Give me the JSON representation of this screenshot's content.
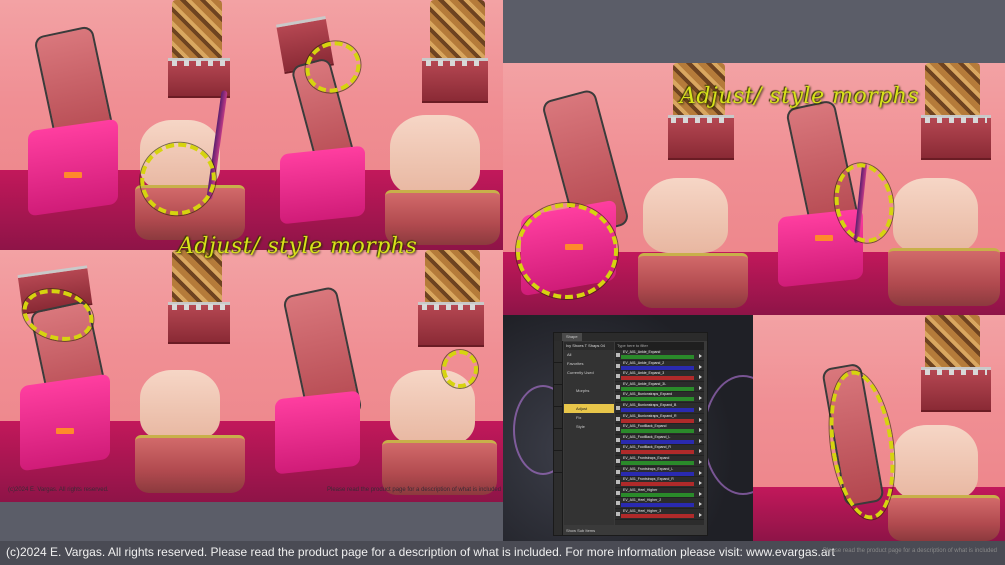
{
  "labels": {
    "style_morphs_left": "Adjust/ style morphs",
    "style_morphs_right": "Adjust/ style morphs"
  },
  "credits": {
    "left_small": "(c)2024 E. Vargas. All rights reserved.",
    "left_small_right": "Please read the product page for a description of what is included",
    "footer_main": "(c)2024 E. Vargas. All rights reserved. Please read the product page for a description of what is included. For more information please visit: www.evargas.art",
    "footer_faint": "Please read the product page for a description of what is included"
  },
  "ui": {
    "tabs": [
      "",
      "Shape"
    ],
    "tree_header": "Ivy Shoes T Shaps 04",
    "tree_items": [
      {
        "label": "All",
        "selected": false,
        "indent": false
      },
      {
        "label": "Favorites",
        "selected": false,
        "indent": false
      },
      {
        "label": "Currently Used",
        "selected": false,
        "indent": false
      },
      {
        "label": "",
        "selected": false,
        "indent": false
      },
      {
        "label": "Morphs",
        "selected": false,
        "indent": true
      },
      {
        "label": "",
        "selected": false,
        "indent": true
      },
      {
        "label": "Adjust",
        "selected": true,
        "indent": true
      },
      {
        "label": "Fix",
        "selected": false,
        "indent": true
      },
      {
        "label": "Style",
        "selected": false,
        "indent": true
      }
    ],
    "list_header": "Type here to filter",
    "rows": [
      {
        "label": "EV_A01_Ankle_Expand",
        "color": "#2a8a2a"
      },
      {
        "label": "EV_A01_Ankle_Expand_2",
        "color": "#2a2ab0"
      },
      {
        "label": "EV_A01_Ankle_Expand_3",
        "color": "#b02a2a"
      },
      {
        "label": "EV_A01_Ankle_Expand_3L",
        "color": "#2a8a2a"
      },
      {
        "label": "EV_A01_Bunionstraps_Expand",
        "color": "#2a8a2a"
      },
      {
        "label": "EV_A01_Bunionstraps_Expand_B",
        "color": "#2a2ab0"
      },
      {
        "label": "EV_A01_Bunionstraps_Expand_R",
        "color": "#b02a2a"
      },
      {
        "label": "EV_A01_FootBack_Expand",
        "color": "#2a8a2a"
      },
      {
        "label": "EV_A01_FootBack_Expand_L",
        "color": "#2a2ab0"
      },
      {
        "label": "EV_A01_FootBack_Expand_R",
        "color": "#b02a2a"
      },
      {
        "label": "EV_A01_Frontstraps_Expand",
        "color": "#2a8a2a"
      },
      {
        "label": "EV_A01_Frontstraps_Expand_L",
        "color": "#2a2ab0"
      },
      {
        "label": "EV_A01_Frontstraps_Expand_R",
        "color": "#b02a2a"
      },
      {
        "label": "EV_A01_Heel_Higher",
        "color": "#2a8a2a"
      },
      {
        "label": "EV_A01_Heel_Higher_2",
        "color": "#2a2ab0"
      },
      {
        "label": "EV_A01_Heel_Higher_3",
        "color": "#b02a2a"
      }
    ],
    "bottom_label": "Show Sub Items"
  }
}
